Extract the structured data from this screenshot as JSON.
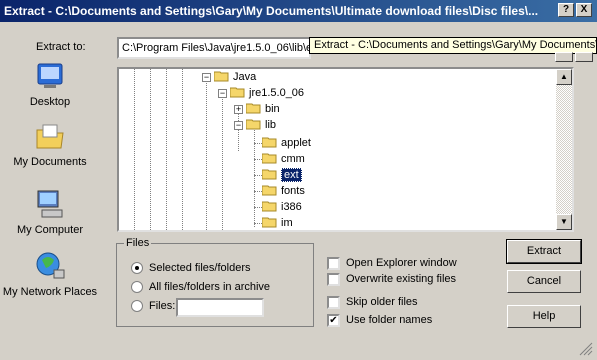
{
  "window": {
    "title": "Extract - C:\\Documents and Settings\\Gary\\My Documents\\Ultimate download files\\Disc files\\...",
    "help_button": "?",
    "close_button": "X"
  },
  "extract_to": {
    "label": "Extract to:",
    "value": "C:\\Program Files\\Java\\jre1.5.0_06\\lib\\ext",
    "tooltip": "Extract - C:\\Documents and Settings\\Gary\\My Documents\\Ultimate download files\\Disc files\\"
  },
  "places": [
    {
      "label": "Desktop",
      "icon": "desktop-icon"
    },
    {
      "label": "My Documents",
      "icon": "my-documents-icon"
    },
    {
      "label": "My Computer",
      "icon": "my-computer-icon"
    },
    {
      "label": "My Network Places",
      "icon": "network-places-icon"
    }
  ],
  "tree": {
    "nodes": [
      {
        "label": "Java",
        "selected": false
      },
      {
        "label": "jre1.5.0_06",
        "selected": false
      },
      {
        "label": "bin",
        "selected": false
      },
      {
        "label": "lib",
        "selected": false
      },
      {
        "label": "applet",
        "selected": false
      },
      {
        "label": "cmm",
        "selected": false
      },
      {
        "label": "ext",
        "selected": true
      },
      {
        "label": "fonts",
        "selected": false
      },
      {
        "label": "i386",
        "selected": false
      },
      {
        "label": "im",
        "selected": false
      }
    ]
  },
  "files_group": {
    "legend": "Files",
    "options": [
      {
        "label": "Selected files/folders",
        "checked": true
      },
      {
        "label": "All files/folders in archive",
        "checked": false
      },
      {
        "label": "Files:",
        "checked": false
      }
    ],
    "files_value": ""
  },
  "checkboxes": [
    {
      "label": "Open Explorer window",
      "checked": false
    },
    {
      "label": "Overwrite existing files",
      "checked": false
    },
    {
      "label": "Skip older files",
      "checked": false
    },
    {
      "label": "Use folder names",
      "checked": true
    }
  ],
  "buttons": {
    "extract": "Extract",
    "cancel": "Cancel",
    "help": "Help"
  }
}
